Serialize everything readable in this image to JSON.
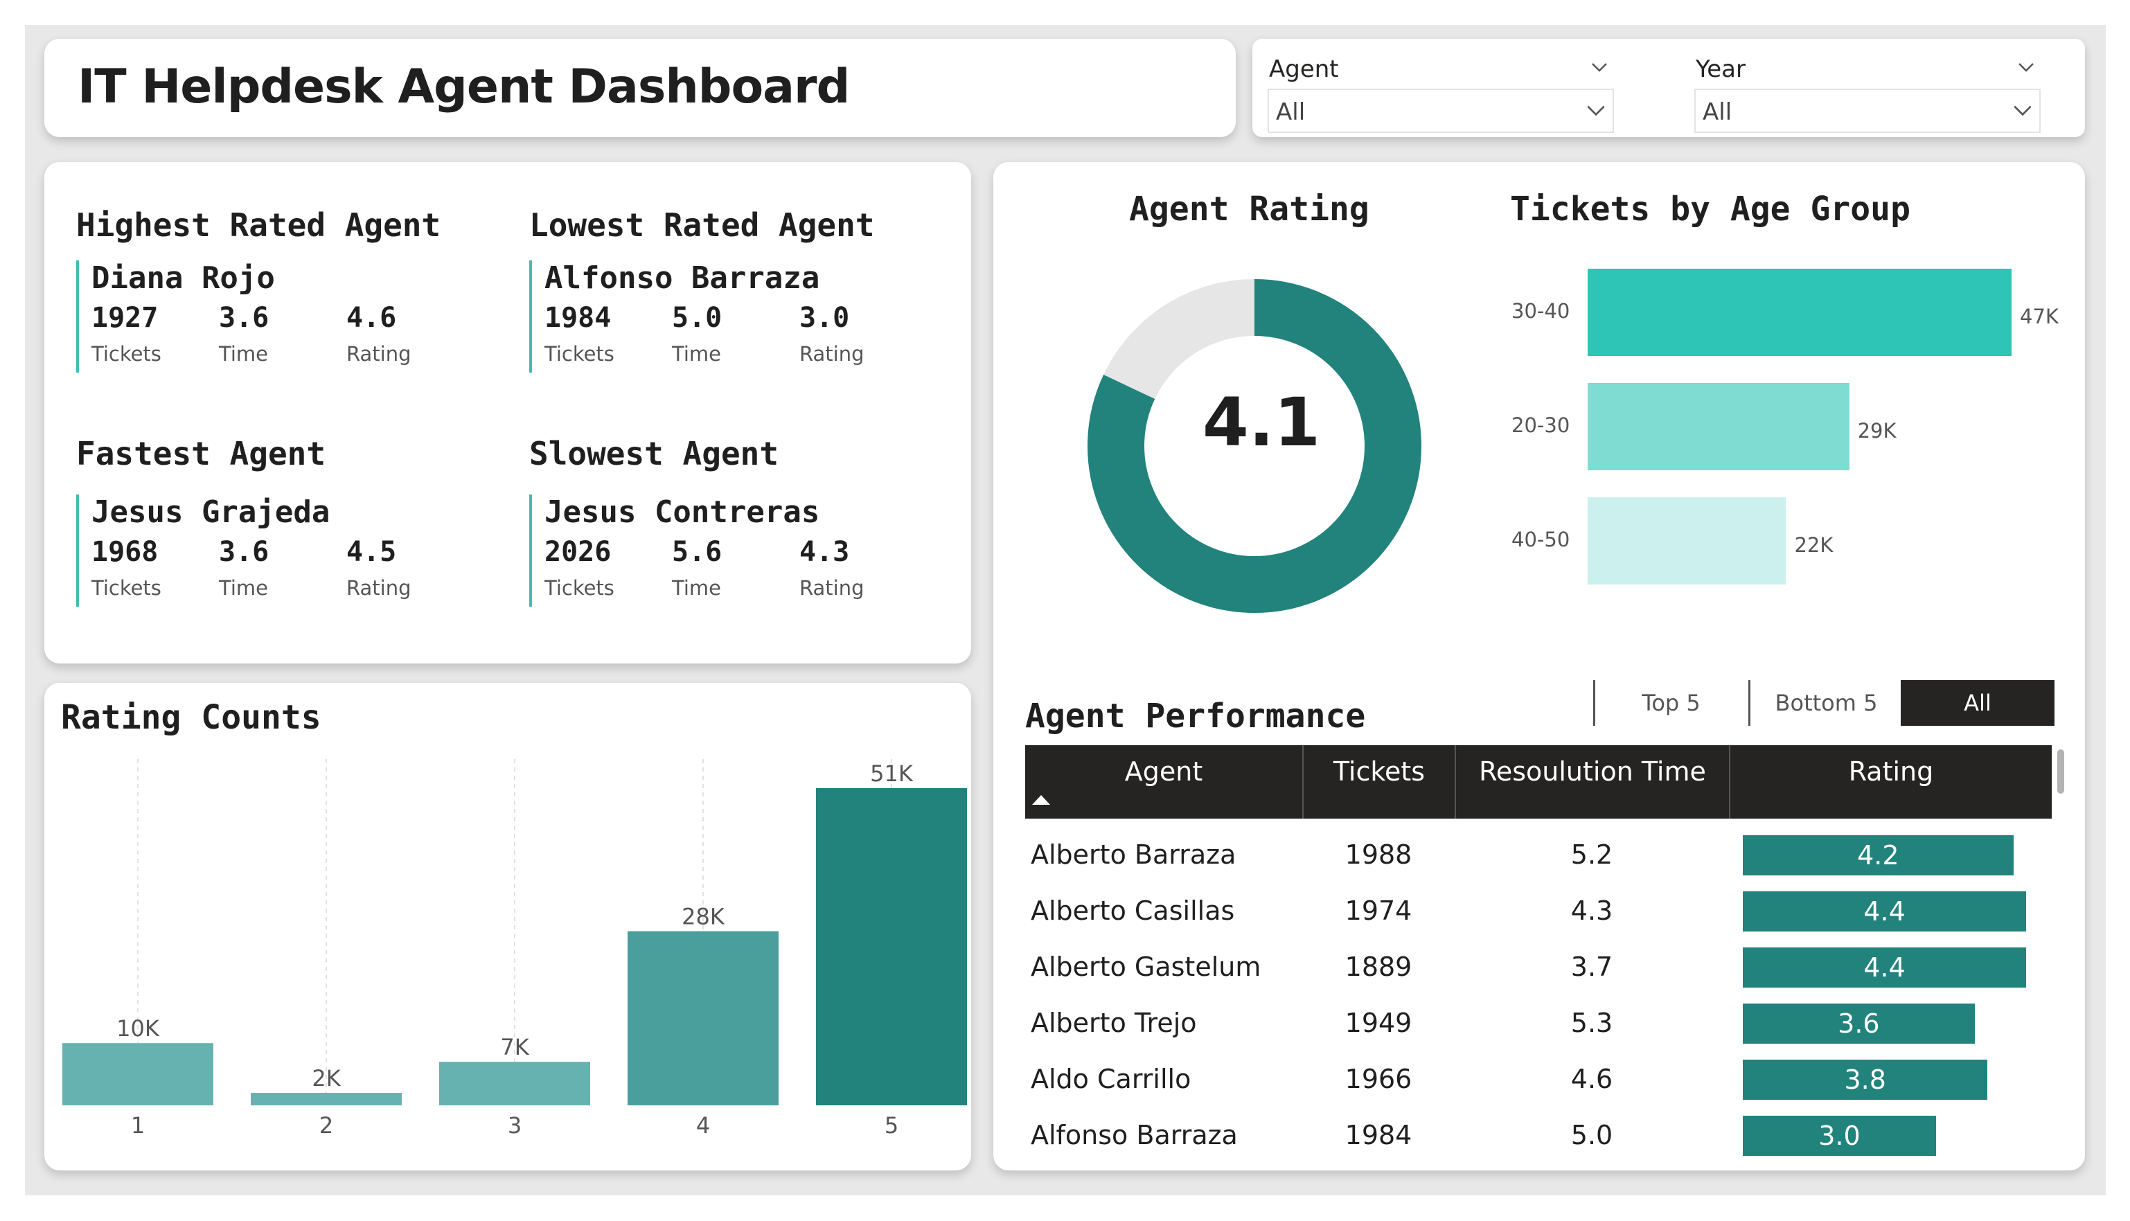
{
  "title": "IT Helpdesk Agent Dashboard",
  "filters": [
    {
      "label": "Agent",
      "value": "All"
    },
    {
      "label": "Year",
      "value": "All"
    }
  ],
  "kpis": [
    {
      "title": "Highest Rated Agent",
      "name": "Diana Rojo",
      "tickets": "1927",
      "time": "3.6",
      "rating": "4.6",
      "tickets_label": "Tickets",
      "time_label": "Time",
      "rating_label": "Rating"
    },
    {
      "title": "Lowest Rated Agent",
      "name": "Alfonso Barraza",
      "tickets": "1984",
      "time": "5.0",
      "rating": "3.0",
      "tickets_label": "Tickets",
      "time_label": "Time",
      "rating_label": "Rating"
    },
    {
      "title": "Fastest Agent",
      "name": "Jesus Grajeda",
      "tickets": "1968",
      "time": "3.6",
      "rating": "4.5",
      "tickets_label": "Tickets",
      "time_label": "Time",
      "rating_label": "Rating"
    },
    {
      "title": "Slowest Agent",
      "name": "Jesus Contreras",
      "tickets": "2026",
      "time": "5.6",
      "rating": "4.3",
      "tickets_label": "Tickets",
      "time_label": "Time",
      "rating_label": "Rating"
    }
  ],
  "agent_rating": {
    "title": "Agent Rating",
    "value": "4.1",
    "fraction": 0.82,
    "ring_color": "#21837b",
    "rest_color": "#e6e6e6"
  },
  "age_group": {
    "title": "Tickets by Age Group"
  },
  "rating_counts": {
    "title": "Rating Counts"
  },
  "performance": {
    "title": "Agent Performance",
    "toggles": [
      {
        "label": "Top 5",
        "active": false
      },
      {
        "label": "Bottom 5",
        "active": false
      },
      {
        "label": "All",
        "active": true
      }
    ],
    "columns": [
      "Agent",
      "Tickets",
      "Resoulution Time",
      "Rating"
    ],
    "rows": [
      {
        "agent": "Alberto Barraza",
        "tickets": "1988",
        "time": "5.2",
        "rating": "4.2",
        "rating_value": 4.2
      },
      {
        "agent": "Alberto Casillas",
        "tickets": "1974",
        "time": "4.3",
        "rating": "4.4",
        "rating_value": 4.4
      },
      {
        "agent": "Alberto Gastelum",
        "tickets": "1889",
        "time": "3.7",
        "rating": "4.4",
        "rating_value": 4.4
      },
      {
        "agent": "Alberto Trejo",
        "tickets": "1949",
        "time": "5.3",
        "rating": "3.6",
        "rating_value": 3.6
      },
      {
        "agent": "Aldo Carrillo",
        "tickets": "1966",
        "time": "4.6",
        "rating": "3.8",
        "rating_value": 3.8
      },
      {
        "agent": "Alfonso Barraza",
        "tickets": "1984",
        "time": "5.0",
        "rating": "3.0",
        "rating_value": 3.0
      }
    ],
    "rating_bar_color": "#21837b"
  },
  "chart_data": [
    {
      "type": "bar",
      "title": "Rating Counts",
      "categories": [
        "1",
        "2",
        "3",
        "4",
        "5"
      ],
      "values": [
        10000,
        2000,
        7000,
        28000,
        51000
      ],
      "data_labels": [
        "10K",
        "2K",
        "7K",
        "28K",
        "51K"
      ],
      "colors": [
        "#66b2b0",
        "#66b2b0",
        "#66b2b0",
        "#4a9e9c",
        "#21837b"
      ],
      "ylim": [
        0,
        51000
      ],
      "grid": false
    },
    {
      "type": "bar",
      "orientation": "horizontal",
      "title": "Tickets by Age Group",
      "categories": [
        "30-40",
        "20-30",
        "40-50"
      ],
      "values": [
        47000,
        29000,
        22000
      ],
      "data_labels": [
        "47K",
        "29K",
        "22K"
      ],
      "colors": [
        "#2ec4b6",
        "#7fdcd3",
        "#cbf0ed"
      ],
      "xlim": [
        0,
        47000
      ]
    },
    {
      "type": "pie",
      "title": "Agent Rating",
      "values": [
        4.1,
        0.9
      ],
      "center_label": "4.1",
      "colors": [
        "#21837b",
        "#e6e6e6"
      ]
    }
  ]
}
